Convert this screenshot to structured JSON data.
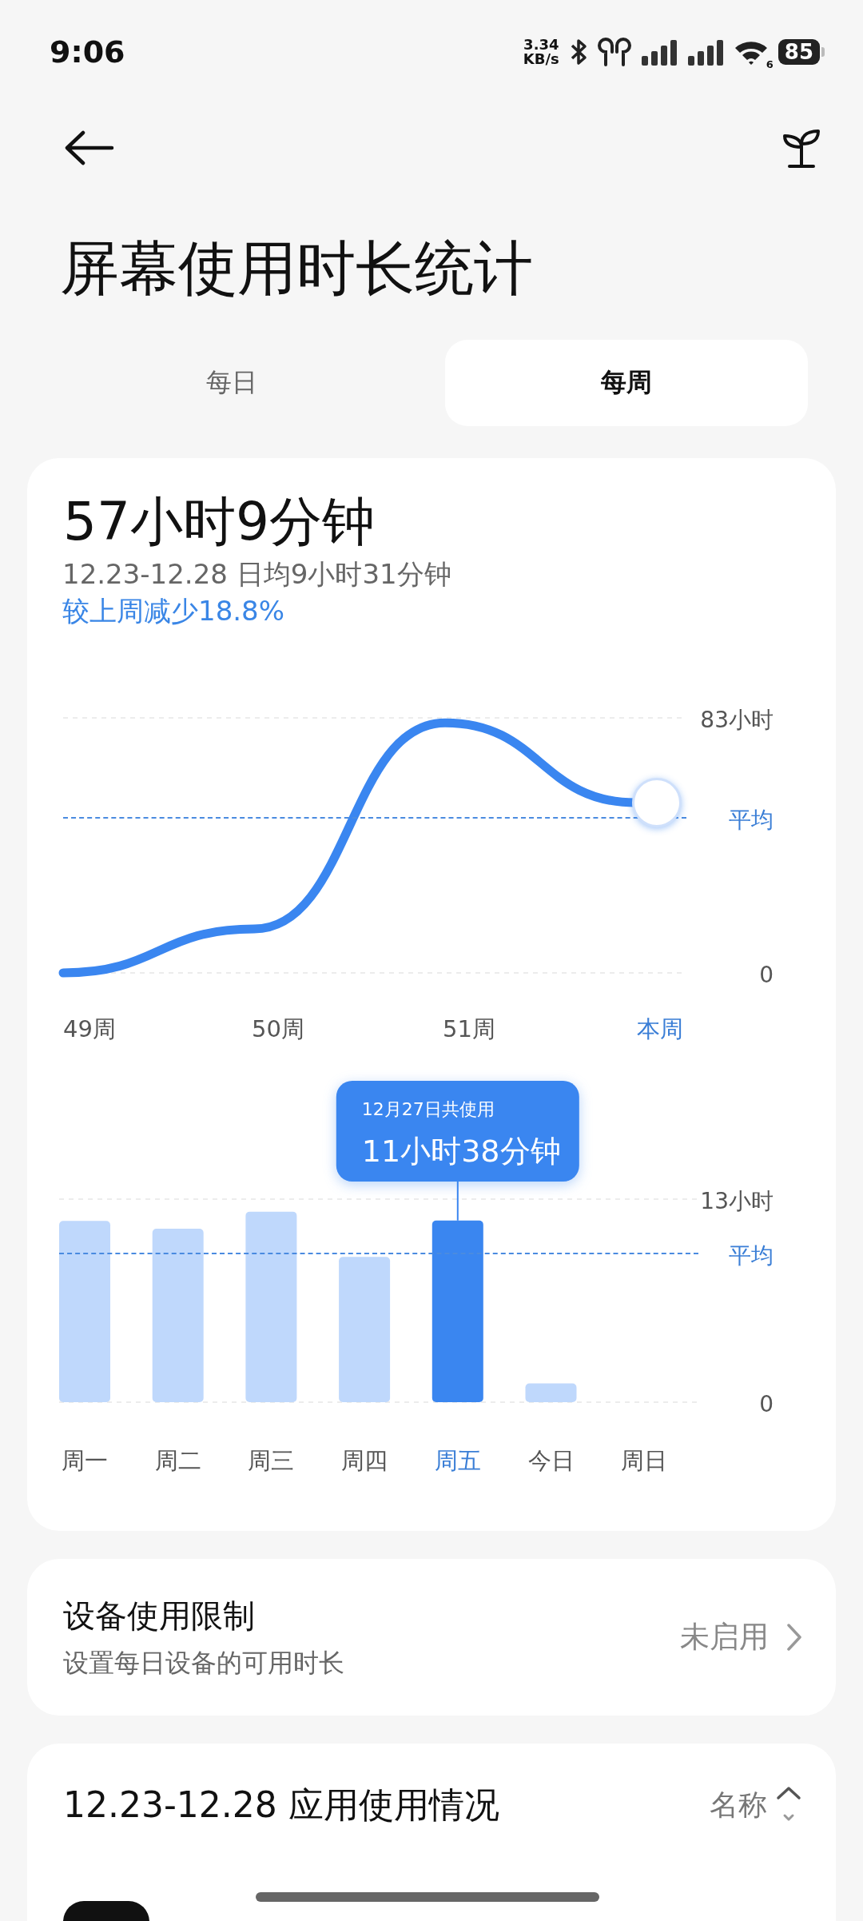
{
  "status_bar": {
    "time": "9:06",
    "net_speed": "3.34",
    "net_unit": "KB/s",
    "wifi_badge": "6",
    "battery": "85"
  },
  "title": "屏幕使用时长统计",
  "tabs": [
    {
      "label": "每日",
      "selected": false
    },
    {
      "label": "每周",
      "selected": true
    }
  ],
  "summary": {
    "total": "57小时9分钟",
    "range_avg": "12.23-12.28 日均9小时31分钟",
    "change": "较上周减少18.8%"
  },
  "weekly_chart": {
    "chart_data": {
      "type": "line",
      "categories": [
        "49周",
        "50周",
        "51周",
        "本周"
      ],
      "series": [
        {
          "color": "#3a86f0",
          "values": [
            0,
            14.3,
            81.4,
            55.4
          ]
        }
      ],
      "ylim": [
        0,
        83
      ],
      "yticks": [
        0,
        {
          "value": 83,
          "label": "83小时"
        }
      ]
    },
    "average_label": "平均"
  },
  "daily_chart": {
    "chart_data": {
      "type": "bar",
      "categories": [
        "周一",
        "周二",
        "周三",
        "周四",
        "周五",
        "今日",
        "周日"
      ],
      "series": [
        {
          "color": "#bfd8fc",
          "values": [
            11.6,
            11.1,
            12.2,
            9.3,
            null,
            1.2,
            null
          ]
        },
        {
          "color": "#3a86f0",
          "values": [
            null,
            null,
            null,
            null,
            11.63,
            null,
            null
          ]
        }
      ],
      "ylim": [
        0,
        13
      ],
      "yticks": [
        0,
        {
          "value": 13,
          "label": "13小时"
        }
      ]
    },
    "average_label": "平均",
    "tooltip": {
      "title": "12月27日共使用",
      "text": "11小时38分钟"
    }
  },
  "limit": {
    "title": "设备使用限制",
    "subtitle": "设置每日设备的可用时长",
    "status": "未启用"
  },
  "apps": {
    "title": "12.23-12.28 应用使用情况",
    "sort": "名称"
  }
}
